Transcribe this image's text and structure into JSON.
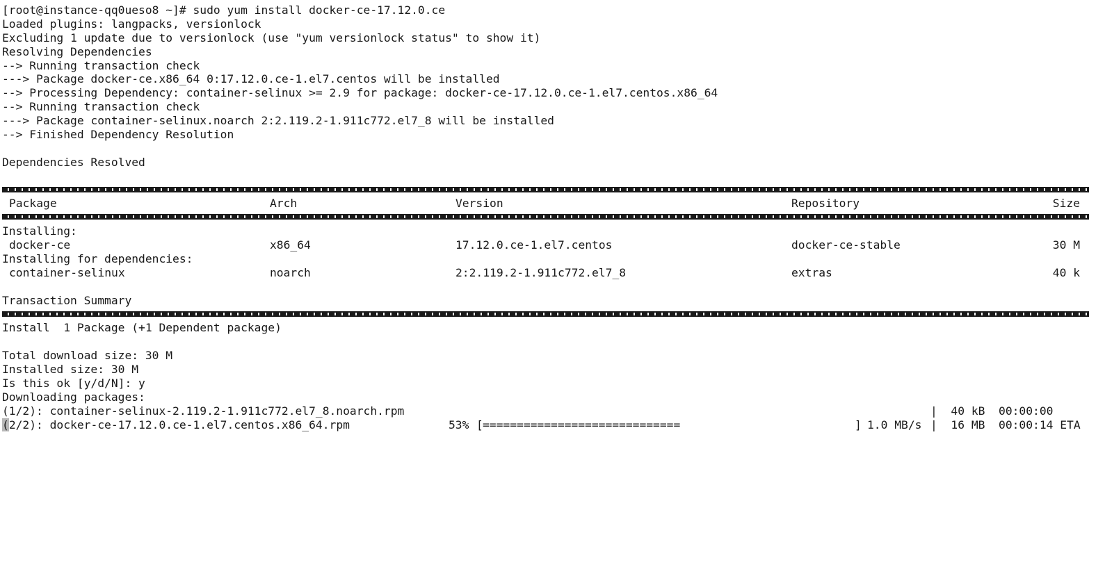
{
  "terminal": {
    "lines": [
      "[root@instance-qq0ueso8 ~]# sudo yum install docker-ce-17.12.0.ce",
      "Loaded plugins: langpacks, versionlock",
      "Excluding 1 update due to versionlock (use \"yum versionlock status\" to show it)",
      "Resolving Dependencies",
      "--> Running transaction check",
      "---> Package docker-ce.x86_64 0:17.12.0.ce-1.el7.centos will be installed",
      "--> Processing Dependency: container-selinux >= 2.9 for package: docker-ce-17.12.0.ce-1.el7.centos.x86_64",
      "--> Running transaction check",
      "---> Package container-selinux.noarch 2:2.119.2-1.911c772.el7_8 will be installed",
      "--> Finished Dependency Resolution",
      "",
      "Dependencies Resolved"
    ],
    "table": {
      "headers": {
        "package": "Package",
        "arch": "Arch",
        "version": "Version",
        "repository": "Repository",
        "size": "Size"
      },
      "installing_label": "Installing:",
      "deps_label": "Installing for dependencies:",
      "rows": [
        {
          "package": "docker-ce",
          "arch": "x86_64",
          "version": "17.12.0.ce-1.el7.centos",
          "repository": "docker-ce-stable",
          "size": "30 M"
        },
        {
          "package": "container-selinux",
          "arch": "noarch",
          "version": "2:2.119.2-1.911c772.el7_8",
          "repository": "extras",
          "size": "40 k"
        }
      ]
    },
    "summary": {
      "title": "Transaction Summary",
      "install_line": "Install  1 Package (+1 Dependent package)",
      "total_download": "Total download size: 30 M",
      "installed_size": "Installed size: 30 M",
      "prompt": "Is this ok [y/d/N]: y",
      "downloading": "Downloading packages:"
    },
    "downloads": [
      {
        "name": "(1/2): container-selinux-2.119.2-1.911c772.el7_8.noarch.rpm",
        "stats": "|  40 kB  00:00:00    "
      },
      {
        "cursor_char": "(",
        "name_rest": "2/2): docker-ce-17.12.0.ce-1.el7.centos.x86_64.rpm",
        "percent": "53%",
        "bar_open": "[",
        "bar_fill": "=============================",
        "bar_close": "]",
        "progress": 0.53,
        "rate": "1.0 MB/s",
        "stats": "|  16 MB  00:00:14 ETA"
      }
    ]
  }
}
